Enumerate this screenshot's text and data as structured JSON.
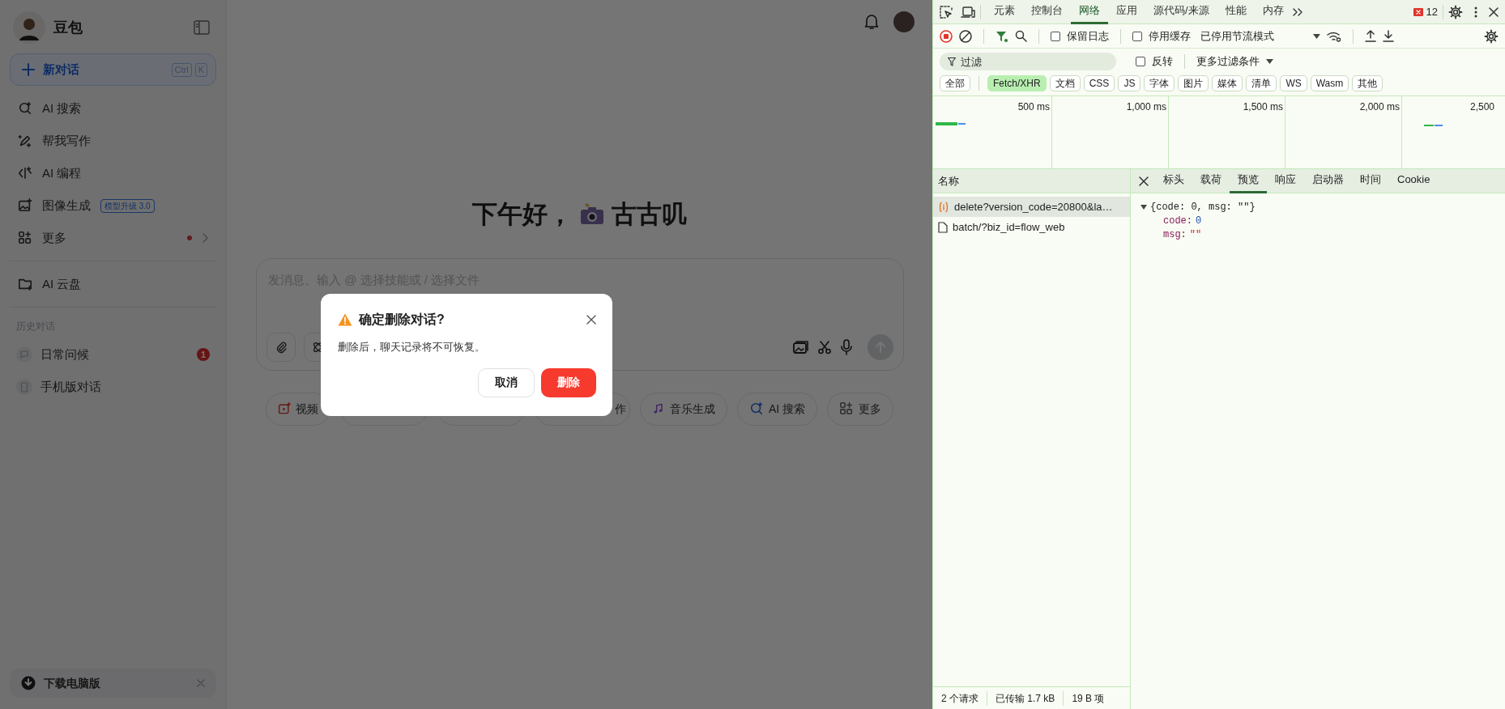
{
  "sidebar": {
    "title": "豆包",
    "new_chat": {
      "label": "新对话",
      "shortcut": [
        "Ctrl",
        "K"
      ]
    },
    "items": [
      {
        "kind": "search",
        "label": "AI 搜索"
      },
      {
        "kind": "write",
        "label": "帮我写作"
      },
      {
        "kind": "code",
        "label": "AI 编程"
      },
      {
        "kind": "image",
        "label": "图像生成",
        "tag": "模型升级 3.0"
      },
      {
        "kind": "more",
        "label": "更多",
        "dot": true
      }
    ],
    "drive": {
      "label": "AI 云盘"
    },
    "history_heading": "历史对话",
    "history": [
      {
        "kind": "chat",
        "label": "日常问候",
        "badge": "1"
      },
      {
        "kind": "phone",
        "label": "手机版对话"
      }
    ],
    "download": {
      "label": "下载电脑版"
    }
  },
  "main": {
    "greeting": "下午好，",
    "name": "古古叽",
    "input": {
      "placeholder": "发消息、输入 @ 选择技能或 / 选择文件"
    },
    "chips": [
      {
        "kind": "video",
        "label": "视频"
      },
      {
        "kind": "hidden"
      },
      {
        "kind": "hidden"
      },
      {
        "kind": "tail",
        "label": "作"
      },
      {
        "kind": "music",
        "label": "音乐生成"
      },
      {
        "kind": "search",
        "label": "AI 搜索"
      },
      {
        "kind": "more",
        "label": "更多"
      }
    ]
  },
  "dialog": {
    "title": "确定删除对话?",
    "message": "删除后，聊天记录将不可恢复。",
    "buttons": [
      {
        "kind": "cancel",
        "label": "取消"
      },
      {
        "kind": "danger",
        "label": "删除"
      }
    ]
  },
  "devtools": {
    "tabs": [
      {
        "label": "元素",
        "selected": false
      },
      {
        "label": "控制台",
        "selected": false
      },
      {
        "label": "网络",
        "selected": true
      },
      {
        "label": "应用",
        "selected": false
      },
      {
        "label": "源代码/来源",
        "selected": false
      },
      {
        "label": "性能",
        "selected": false
      },
      {
        "label": "内存",
        "selected": false
      }
    ],
    "error_count": "12",
    "toolbar": {
      "preserve_log": {
        "label": "保留日志",
        "checked": false
      },
      "disable_cache": {
        "label": "停用缓存",
        "checked": false
      },
      "throttling": "已停用节流模式"
    },
    "filter": {
      "placeholder": "过滤",
      "invert": {
        "label": "反转",
        "checked": false
      },
      "more_filters": "更多过滤条件"
    },
    "types": [
      {
        "label": "全部",
        "selected": false
      },
      {
        "label": "Fetch/XHR",
        "selected": true
      },
      {
        "label": "文档",
        "selected": false
      },
      {
        "label": "CSS",
        "selected": false
      },
      {
        "label": "JS",
        "selected": false
      },
      {
        "label": "字体",
        "selected": false
      },
      {
        "label": "图片",
        "selected": false
      },
      {
        "label": "媒体",
        "selected": false
      },
      {
        "label": "清单",
        "selected": false
      },
      {
        "label": "WS",
        "selected": false
      },
      {
        "label": "Wasm",
        "selected": false
      },
      {
        "label": "其他",
        "selected": false
      }
    ],
    "timeline": {
      "ticks": [
        "500 ms",
        "1,000 ms",
        "1,500 ms",
        "2,000 ms",
        "2,500"
      ]
    },
    "requests": {
      "heading": "名称",
      "rows": [
        {
          "kind": "xhr",
          "name": "delete?version_code=20800&la…",
          "selected": true
        },
        {
          "kind": "doc",
          "name": "batch/?biz_id=flow_web",
          "selected": false
        }
      ]
    },
    "detail_tabs": [
      {
        "label": "标头",
        "selected": false
      },
      {
        "label": "载荷",
        "selected": false
      },
      {
        "label": "预览",
        "selected": true
      },
      {
        "label": "响应",
        "selected": false
      },
      {
        "label": "启动器",
        "selected": false
      },
      {
        "label": "时间",
        "selected": false
      },
      {
        "label": "Cookie",
        "selected": false
      }
    ],
    "preview": {
      "summary": "{code: 0, msg: \"\"}",
      "expanded": true,
      "fields": [
        {
          "kind": "number",
          "key": "code:",
          "value": "0"
        },
        {
          "kind": "string",
          "key": "msg:",
          "value": "\"\""
        }
      ]
    },
    "status": [
      "2 个请求",
      "已传输 1.7 kB",
      "19 B 项"
    ]
  }
}
